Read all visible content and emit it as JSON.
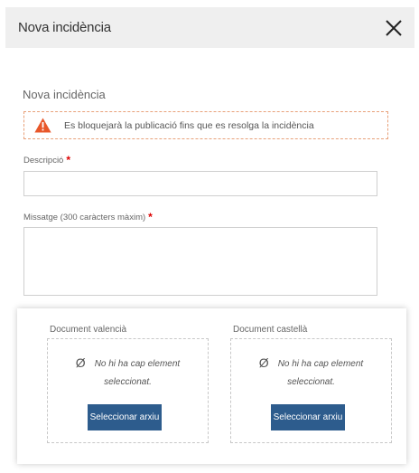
{
  "header": {
    "title": "Nova incidència",
    "close_icon": "close-icon"
  },
  "form": {
    "section_title": "Nova incidència",
    "warning": {
      "icon": "warning-triangle-icon",
      "color": "#e8572a",
      "text": "Es bloquejarà la publicació fins que es resolga la incidència"
    },
    "description": {
      "label": "Descripció",
      "required_mark": "*",
      "value": ""
    },
    "message": {
      "label": "Missatge (300 caràcters màxim)",
      "required_mark": "*",
      "value": ""
    }
  },
  "documents": {
    "valencia": {
      "label": "Document valencià",
      "empty_icon": "Ø",
      "empty_line1": "No hi ha cap element",
      "empty_line2": "seleccionat.",
      "button_label": "Seleccionar arxiu"
    },
    "castella": {
      "label": "Document castellà",
      "empty_icon": "Ø",
      "empty_line1": "No hi ha cap element",
      "empty_line2": "seleccionat.",
      "button_label": "Seleccionar arxiu"
    },
    "button_color": "#2d5c8d"
  }
}
